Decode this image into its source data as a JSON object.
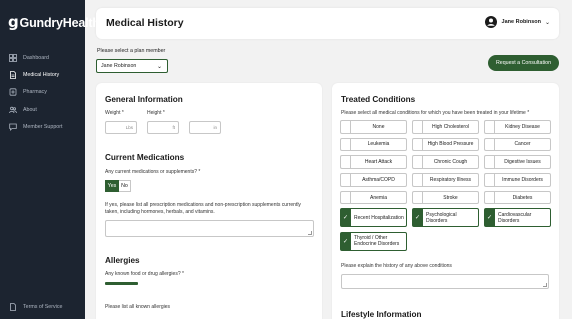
{
  "app": {
    "brand": "GundryHealth",
    "brand_mark": "g"
  },
  "sidebar": {
    "items": [
      {
        "label": "Dashboard",
        "icon": "grid-icon",
        "active": false
      },
      {
        "label": "Medical History",
        "icon": "document-icon",
        "active": true
      },
      {
        "label": "Pharmacy",
        "icon": "pill-icon",
        "active": false
      },
      {
        "label": "About",
        "icon": "people-icon",
        "active": false
      },
      {
        "label": "Member Support",
        "icon": "chat-icon",
        "active": false
      }
    ],
    "terms": "Terms of Service"
  },
  "header": {
    "title": "Medical History",
    "user_name": "Jane Robinson"
  },
  "plan": {
    "label": "Please select a plan member",
    "selected": "Jane Robinson"
  },
  "actions": {
    "consult_label": "Request a Consultation"
  },
  "general": {
    "title": "General Information",
    "weight_label": "Weight *",
    "weight_unit": "Lbs",
    "height_label": "Height *",
    "height_ft_unit": "ft",
    "height_in_unit": "in"
  },
  "medications": {
    "title": "Current Medications",
    "question": "Any current medications or supplements? *",
    "yes": "Yes",
    "no": "No",
    "list_prompt": "If yes, please list all prescription medications and non-prescription supplements currently taken, including hormones, herbals, and vitamins."
  },
  "allergies": {
    "title": "Allergies",
    "question": "Any known food or drug allergies? *",
    "list_prompt": "Please list all known allergies"
  },
  "conditions": {
    "title": "Treated Conditions",
    "instruction": "Please select all medical conditions for which you have been treated in your lifetime *",
    "items": [
      {
        "label": "None",
        "checked": false
      },
      {
        "label": "High Cholesterol",
        "checked": false
      },
      {
        "label": "Kidney Disease",
        "checked": false
      },
      {
        "label": "Leukemia",
        "checked": false
      },
      {
        "label": "High Blood Pressure",
        "checked": false
      },
      {
        "label": "Cancer",
        "checked": false
      },
      {
        "label": "Heart Attack",
        "checked": false
      },
      {
        "label": "Chronic Cough",
        "checked": false
      },
      {
        "label": "Digestive Issues",
        "checked": false
      },
      {
        "label": "Asthma/COPD",
        "checked": false
      },
      {
        "label": "Respiratory Illness",
        "checked": false
      },
      {
        "label": "Immune Disorders",
        "checked": false
      },
      {
        "label": "Anemia",
        "checked": false
      },
      {
        "label": "Stroke",
        "checked": false
      },
      {
        "label": "Diabetes",
        "checked": false
      },
      {
        "label": "Recent Hospitalization",
        "checked": true
      },
      {
        "label": "Psychological Disorders",
        "checked": true
      },
      {
        "label": "Cardiovascular Disorders",
        "checked": true
      },
      {
        "label": "Thyroid / Other Endocrine Disorders",
        "checked": true
      }
    ],
    "explain_prompt": "Please explain the history of any above conditions"
  },
  "lifestyle": {
    "title": "Lifestyle Information"
  },
  "colors": {
    "sidebar": "#1c2430",
    "accent": "#2e5e31",
    "background": "#f2f2f2"
  }
}
